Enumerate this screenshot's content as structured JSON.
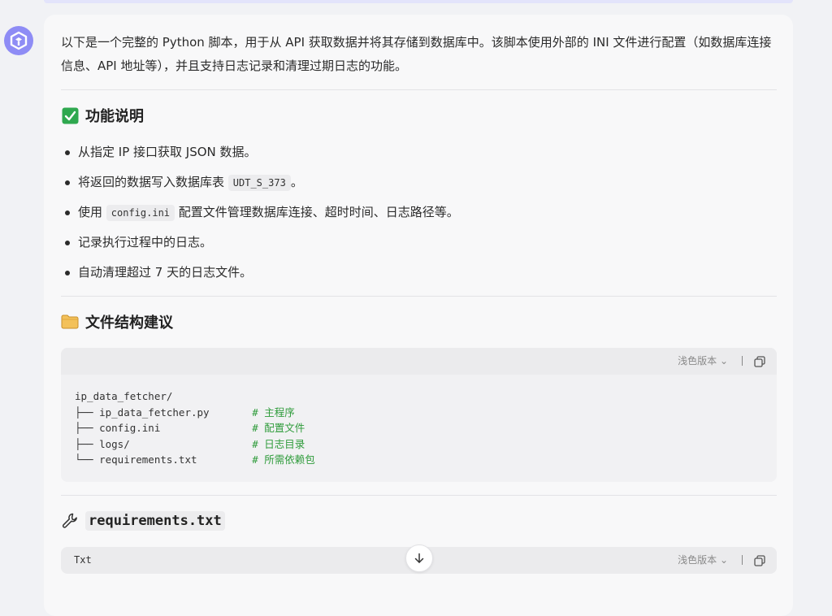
{
  "message": {
    "intro": "以下是一个完整的 Python 脚本，用于从 API 获取数据并将其存储到数据库中。该脚本使用外部的 INI 文件进行配置（如数据库连接信息、API 地址等），并且支持日志记录和清理过期日志的功能。",
    "sections": {
      "features": {
        "icon": "check-box-icon",
        "title": "功能说明",
        "items": [
          {
            "text": "从指定 IP 接口获取 JSON 数据。"
          },
          {
            "pre": "将返回的数据写入数据库表 ",
            "code": "UDT_S_373",
            "post": "。"
          },
          {
            "pre": "使用 ",
            "code": "config.ini",
            "post": " 配置文件管理数据库连接、超时时间、日志路径等。"
          },
          {
            "text": "记录执行过程中的日志。"
          },
          {
            "text": "自动清理超过 7 天的日志文件。"
          }
        ]
      },
      "structure": {
        "icon": "folder-icon",
        "title": "文件结构建议",
        "theme_label": "浅色版本",
        "lines": [
          {
            "code": "ip_data_fetcher/",
            "comment": ""
          },
          {
            "code": "├── ip_data_fetcher.py       ",
            "comment": "# 主程序"
          },
          {
            "code": "├── config.ini               ",
            "comment": "# 配置文件"
          },
          {
            "code": "├── logs/                    ",
            "comment": "# 日志目录"
          },
          {
            "code": "└── requirements.txt         ",
            "comment": "# 所需依赖包"
          }
        ]
      },
      "requirements": {
        "icon": "wrench-icon",
        "title": "requirements.txt",
        "lang": "Txt",
        "theme_label": "浅色版本"
      }
    }
  }
}
